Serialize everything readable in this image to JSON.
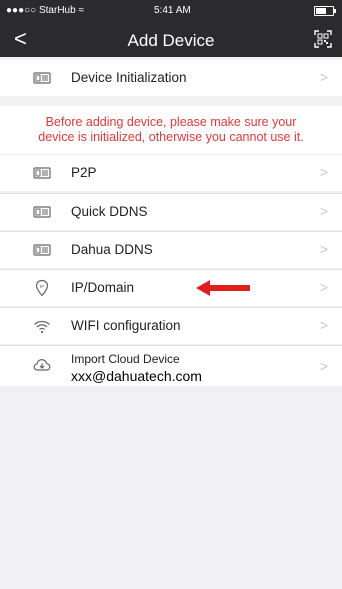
{
  "status": {
    "carrier": "●●●○○ StarHub ≈",
    "time": "5:41 AM"
  },
  "header": {
    "title": "Add Device",
    "back_label": "<"
  },
  "items": {
    "init": {
      "label": "Device Initialization"
    },
    "warning": {
      "line1": "Before adding device, please make sure your",
      "line2": "device is initialized, otherwise you cannot use it."
    },
    "p2p": {
      "label": "P2P"
    },
    "quick": {
      "label": "Quick DDNS"
    },
    "dahua": {
      "label": "Dahua DDNS"
    },
    "ip": {
      "label": "IP/Domain"
    },
    "wifi": {
      "label": "WIFI configuration"
    },
    "cloud": {
      "label": "Import Cloud Device",
      "sub": "xxx@dahuatech.com"
    }
  },
  "chevron": ">",
  "colors": {
    "header_bg": "#2b2b2e",
    "warning": "#e23a3a",
    "arrow": "#e02020"
  },
  "icons": [
    "device-icon",
    "ip-icon",
    "wifi-icon",
    "cloud-download-icon",
    "qr-scan-icon",
    "back-icon",
    "chevron-right-icon"
  ]
}
